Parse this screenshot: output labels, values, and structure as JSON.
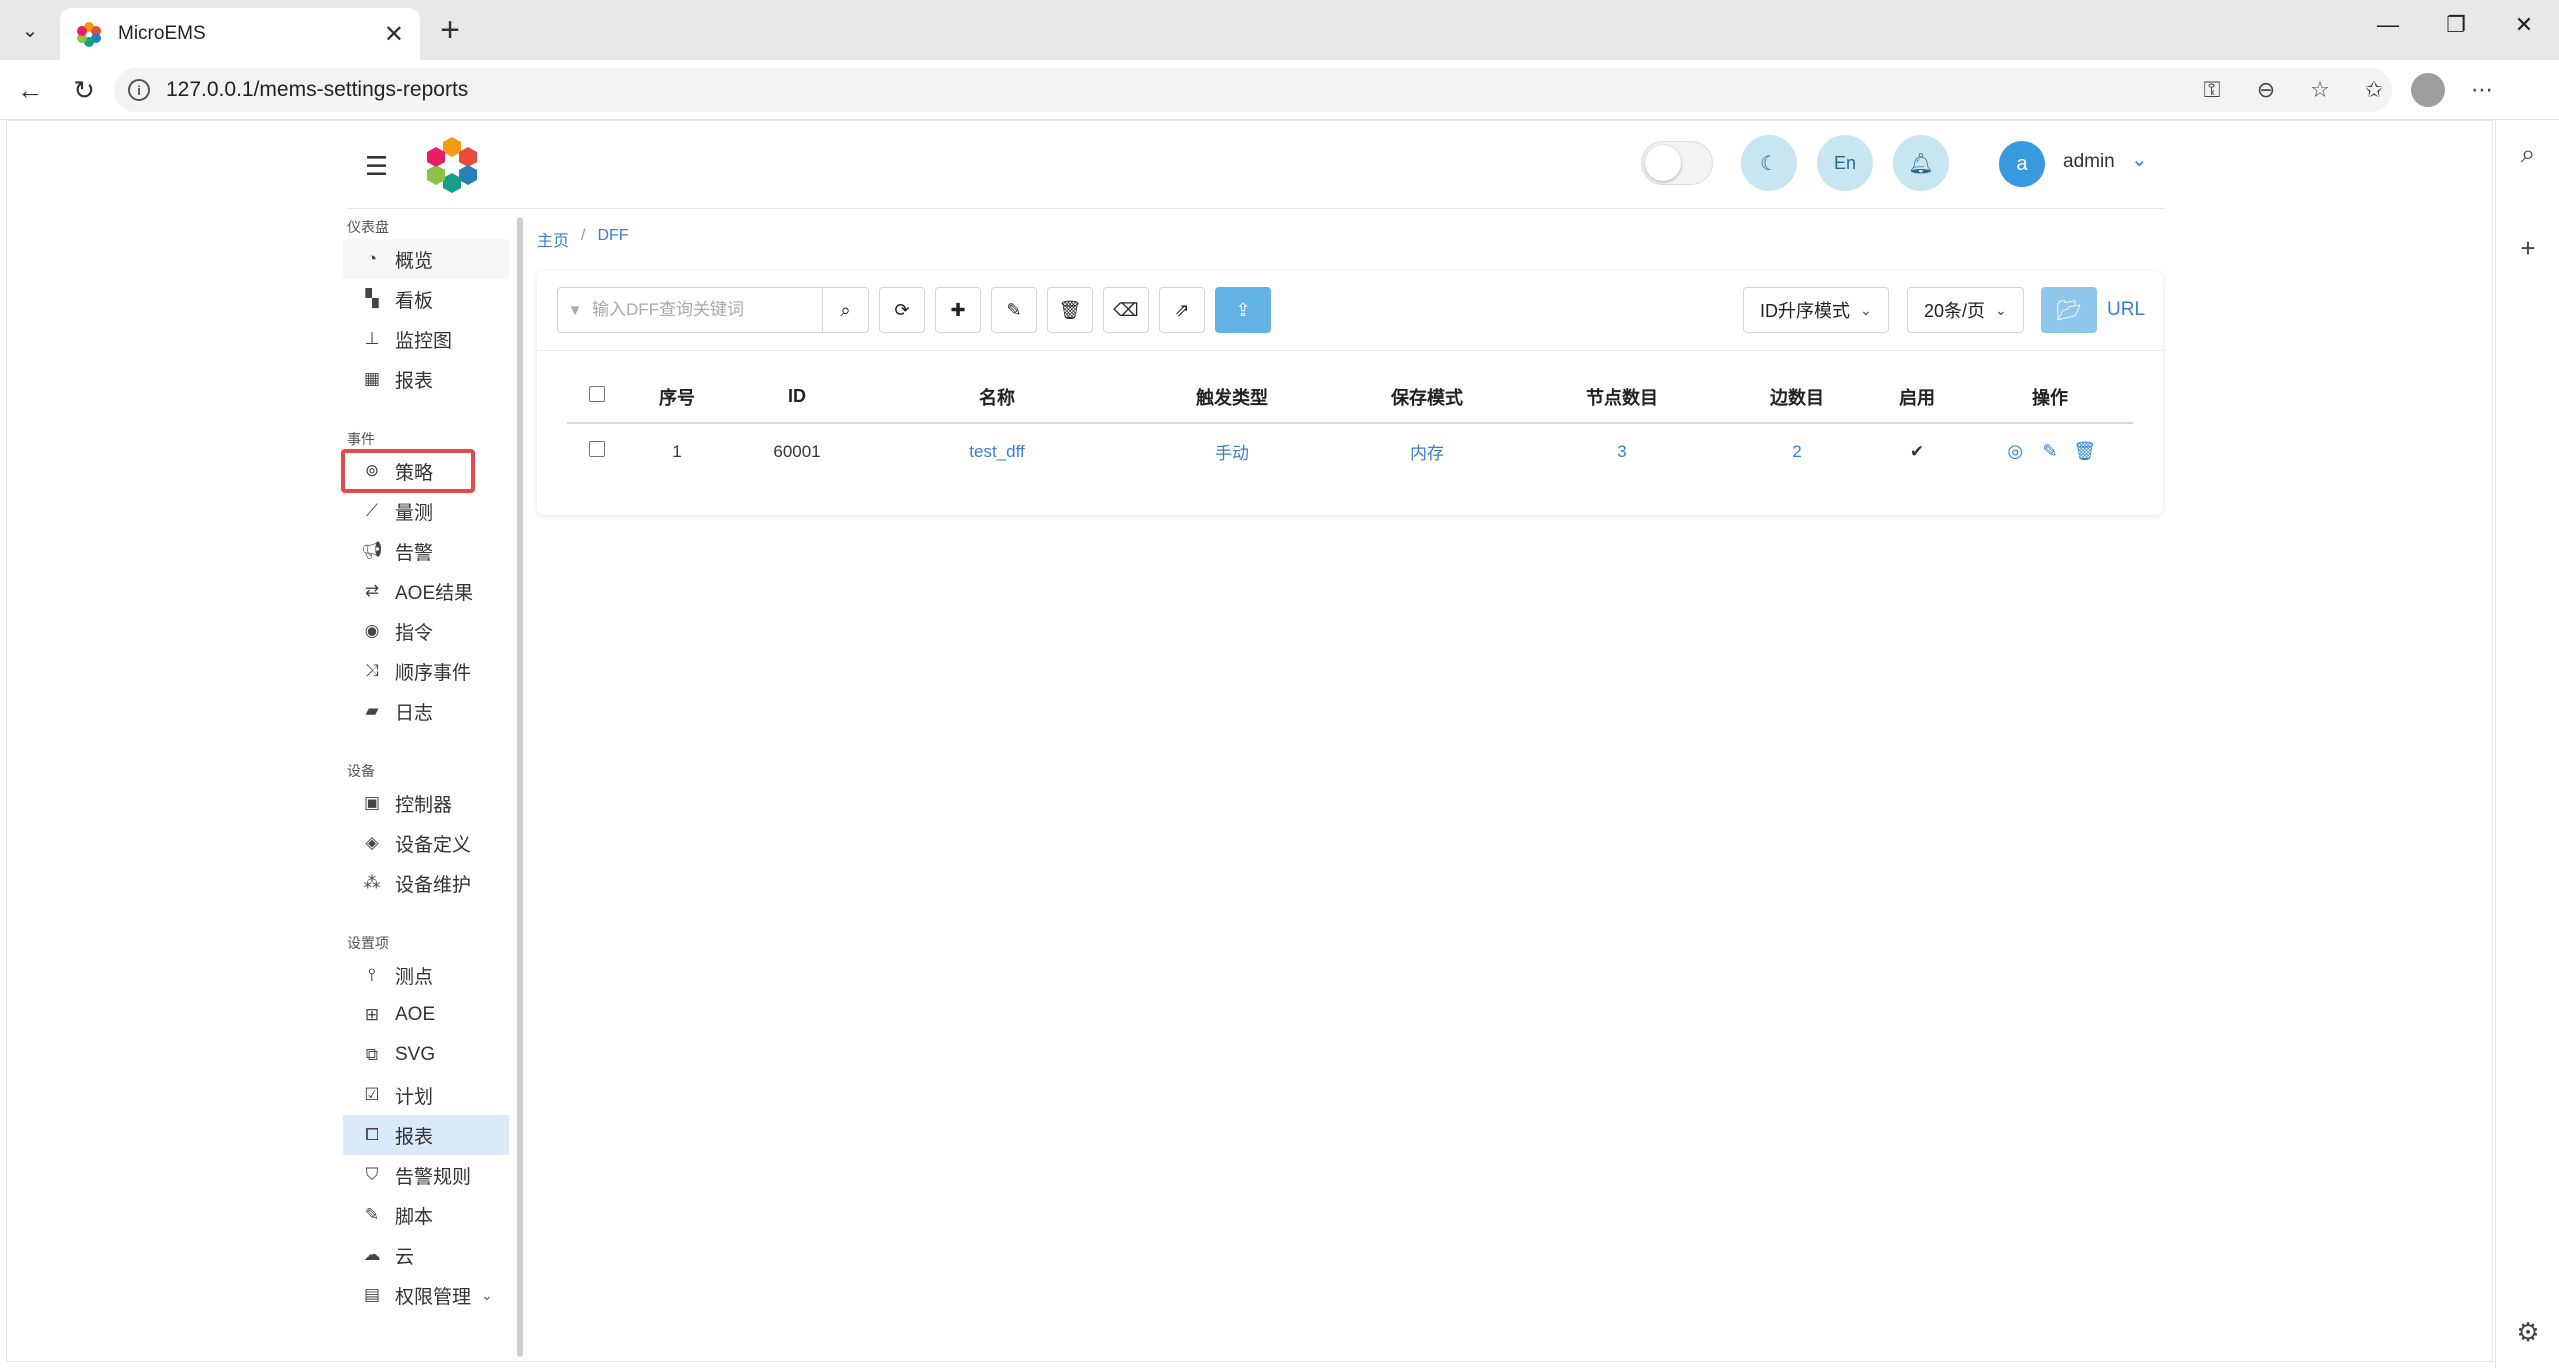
{
  "browser": {
    "tab_title": "MicroEMS",
    "url": "127.0.0.1/mems-settings-reports"
  },
  "header": {
    "lang_label": "En",
    "user_initial": "a",
    "user_name": "admin"
  },
  "sidebar": {
    "groups": [
      {
        "label": "仪表盘",
        "items": [
          "概览",
          "看板",
          "监控图",
          "报表"
        ]
      },
      {
        "label": "事件",
        "items": [
          "策略",
          "量测",
          "告警",
          "AOE结果",
          "指令",
          "顺序事件",
          "日志"
        ]
      },
      {
        "label": "设备",
        "items": [
          "控制器",
          "设备定义",
          "设备维护"
        ]
      },
      {
        "label": "设置项",
        "items": [
          "测点",
          "AOE",
          "SVG",
          "计划",
          "报表",
          "告警规则",
          "脚本",
          "云",
          "权限管理"
        ]
      }
    ],
    "highlighted_item": "策略",
    "active_item": "报表"
  },
  "breadcrumb": {
    "home": "主页",
    "current": "DFF"
  },
  "toolbar": {
    "search_placeholder": "输入DFF查询关键词",
    "sort_mode": "ID升序模式",
    "page_size": "20条/页",
    "url_label": "URL"
  },
  "table": {
    "columns": [
      "序号",
      "ID",
      "名称",
      "触发类型",
      "保存模式",
      "节点数目",
      "边数目",
      "启用",
      "操作"
    ],
    "rows": [
      {
        "index": "1",
        "id": "60001",
        "name": "test_dff",
        "trigger": "手动",
        "save_mode": "内存",
        "nodes": "3",
        "edges": "2",
        "enabled": "✔"
      }
    ]
  },
  "colors": {
    "accent": "#3a7fd0",
    "highlight": "#e14b4b",
    "active_bg": "#dbe9fb",
    "header_btn": "#c7e6f2"
  }
}
